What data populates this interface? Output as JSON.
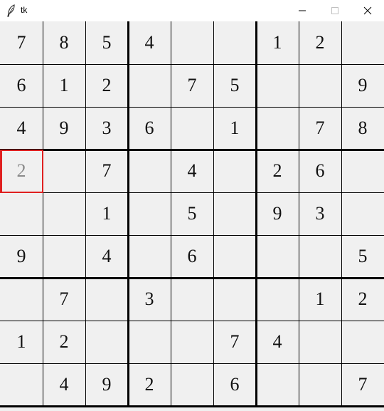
{
  "window": {
    "title": "tk",
    "icon": "feather-icon",
    "buttons": [
      "minimize-icon",
      "maximize-icon",
      "close-icon"
    ]
  },
  "board": {
    "rows": [
      [
        "7",
        "8",
        "5",
        "4",
        "",
        "",
        "1",
        "2",
        ""
      ],
      [
        "6",
        "1",
        "2",
        "",
        "7",
        "5",
        "",
        "",
        "9"
      ],
      [
        "4",
        "9",
        "3",
        "6",
        "",
        "1",
        "",
        "7",
        "8"
      ],
      [
        "2",
        "",
        "7",
        "",
        "4",
        "",
        "2",
        "6",
        ""
      ],
      [
        "",
        "",
        "1",
        "",
        "5",
        "",
        "9",
        "3",
        ""
      ],
      [
        "9",
        "",
        "4",
        "",
        "6",
        "",
        "",
        "",
        "5"
      ],
      [
        "",
        "7",
        "",
        "3",
        "",
        "",
        "",
        "1",
        "2"
      ],
      [
        "1",
        "2",
        "",
        "",
        "",
        "7",
        "4",
        "",
        ""
      ],
      [
        "",
        "4",
        "9",
        "2",
        "",
        "6",
        "",
        "",
        "7"
      ]
    ],
    "selected_cell": {
      "row": 3,
      "col": 0
    },
    "tentative_cells": [
      [
        3,
        0
      ]
    ],
    "colors": {
      "background": "#f0f0f0",
      "grid": "#000000",
      "selection": "#e02020",
      "tentative_text": "#8a8a8a",
      "given_text": "#111111"
    }
  }
}
